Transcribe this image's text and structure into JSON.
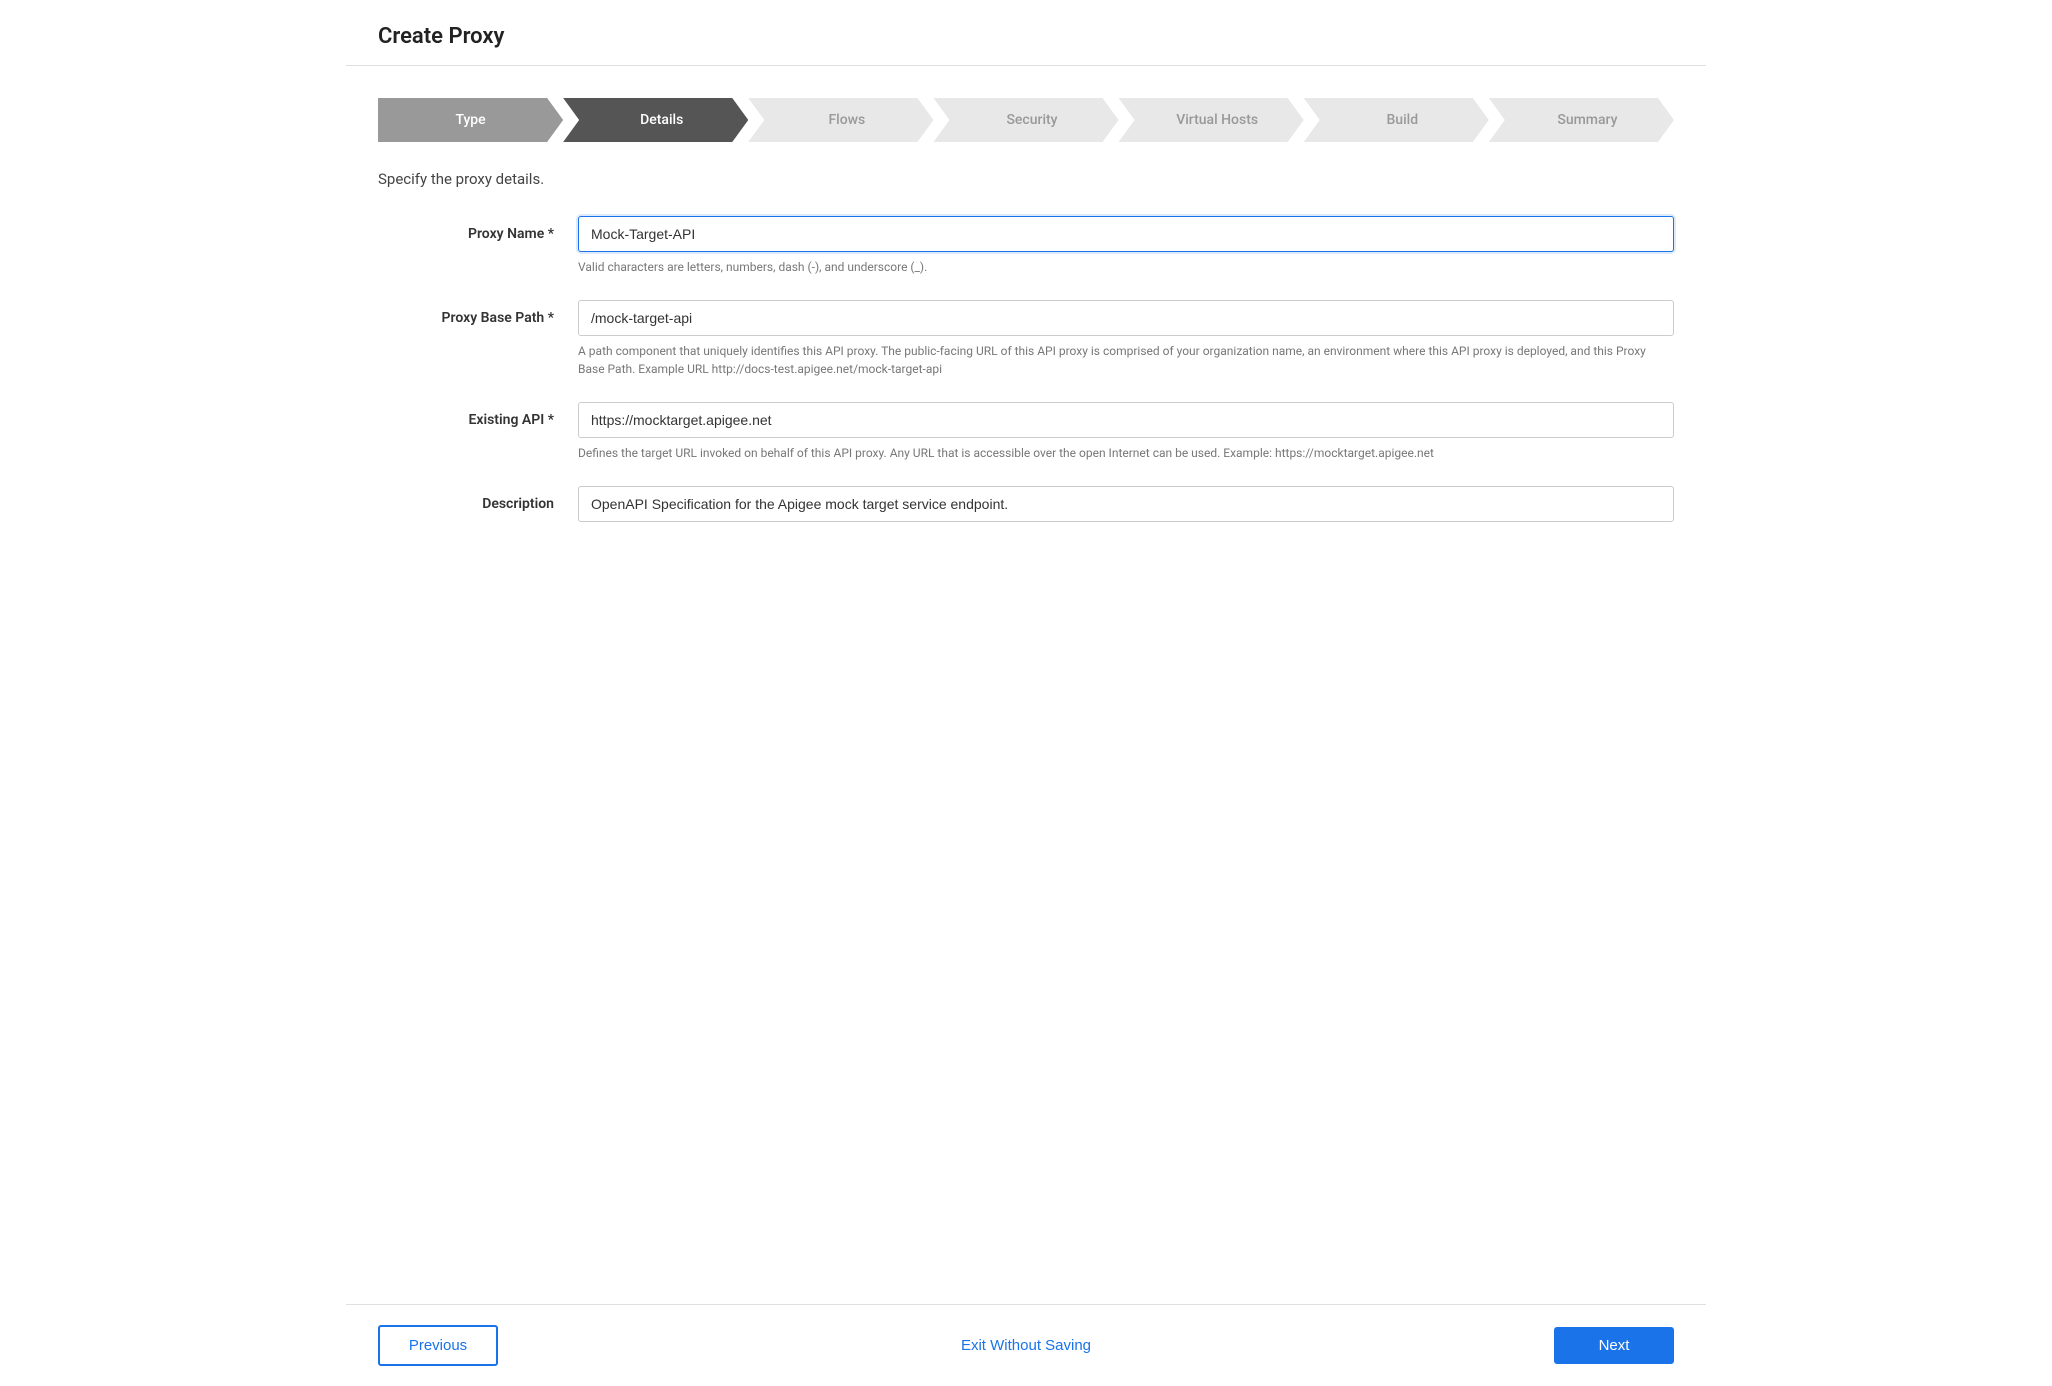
{
  "page": {
    "title": "Create Proxy"
  },
  "stepper": {
    "steps": [
      {
        "id": "type",
        "label": "Type",
        "state": "completed"
      },
      {
        "id": "details",
        "label": "Details",
        "state": "active"
      },
      {
        "id": "flows",
        "label": "Flows",
        "state": "inactive"
      },
      {
        "id": "security",
        "label": "Security",
        "state": "inactive"
      },
      {
        "id": "virtual-hosts",
        "label": "Virtual Hosts",
        "state": "inactive"
      },
      {
        "id": "build",
        "label": "Build",
        "state": "inactive"
      },
      {
        "id": "summary",
        "label": "Summary",
        "state": "inactive"
      }
    ]
  },
  "form": {
    "section_description": "Specify the proxy details.",
    "fields": {
      "proxy_name": {
        "label": "Proxy Name *",
        "value": "Mock-Target-API",
        "hint": "Valid characters are letters, numbers, dash (-), and underscore (_)."
      },
      "proxy_base_path": {
        "label": "Proxy Base Path *",
        "value": "/mock-target-api",
        "hint": "A path component that uniquely identifies this API proxy. The public-facing URL of this API proxy is comprised of your organization name, an environment where this API proxy is deployed, and this Proxy Base Path. Example URL http://docs-test.apigee.net/mock-target-api"
      },
      "existing_api": {
        "label": "Existing API *",
        "value": "https://mocktarget.apigee.net",
        "hint": "Defines the target URL invoked on behalf of this API proxy. Any URL that is accessible over the open Internet can be used. Example: https://mocktarget.apigee.net"
      },
      "description": {
        "label": "Description",
        "value": "OpenAPI Specification for the Apigee mock target service endpoint.",
        "hint": ""
      }
    }
  },
  "footer": {
    "previous_label": "Previous",
    "exit_label": "Exit Without Saving",
    "next_label": "Next"
  }
}
